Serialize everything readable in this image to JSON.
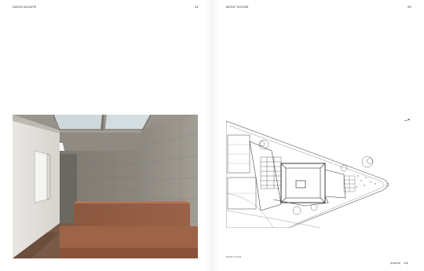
{
  "left_page": {
    "header_title": "DAVID ADJAYE",
    "page_number": "24"
  },
  "right_page": {
    "header_title": "MOLE HOUSE",
    "page_number": "25",
    "plan_caption": "ROOF PLAN"
  },
  "icons": {
    "north_arrow": "north-arrow-icon",
    "scale_bar": "scale-bar-icon"
  },
  "colors": {
    "page": "#ffffff",
    "concrete": "#8f8b83",
    "timber": "#9a5f44",
    "skylight": "#c9d4d8",
    "ink": "#222222"
  }
}
